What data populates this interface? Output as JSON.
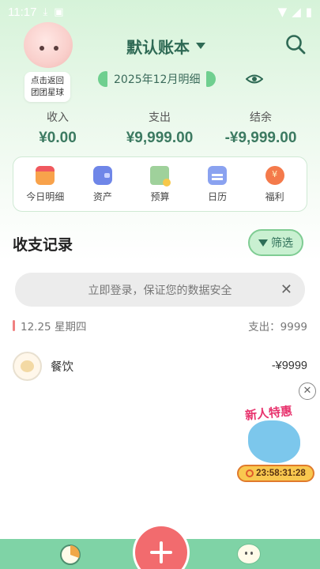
{
  "status_bar": {
    "time": "11:17",
    "icons": [
      "download-icon",
      "app-notification-icon",
      "wifi-icon",
      "signal-icon",
      "battery-icon"
    ]
  },
  "mascot": {
    "tip_line1": "点击返回",
    "tip_line2": "团团星球"
  },
  "header": {
    "book_title": "默认账本",
    "month_label": "2025年12月明细"
  },
  "summary": {
    "income_label": "收入",
    "income_value": "¥0.00",
    "expense_label": "支出",
    "expense_value": "¥9,999.00",
    "balance_label": "结余",
    "balance_value": "-¥9,999.00"
  },
  "quick_menu": [
    {
      "label": "今日明细",
      "icon": "today-detail-icon"
    },
    {
      "label": "资产",
      "icon": "asset-wallet-icon"
    },
    {
      "label": "预算",
      "icon": "budget-icon"
    },
    {
      "label": "日历",
      "icon": "calendar-icon"
    },
    {
      "label": "福利",
      "icon": "welfare-icon"
    }
  ],
  "records": {
    "title": "收支记录",
    "filter_label": "筛选"
  },
  "login_banner": {
    "text": "立即登录，保证您的数据安全",
    "close": "✕"
  },
  "day_group": {
    "date": "12.25 星期四",
    "total": "支出：9999"
  },
  "transactions": [
    {
      "category": "餐饮",
      "amount": "-¥9999"
    }
  ],
  "promo": {
    "title": "新人特惠",
    "countdown": "23:58:31:28",
    "close": "✕"
  },
  "colors": {
    "accent_green": "#2f6a55",
    "bottom_bar": "#7fd3a6",
    "add_button": "#f26b6e"
  }
}
